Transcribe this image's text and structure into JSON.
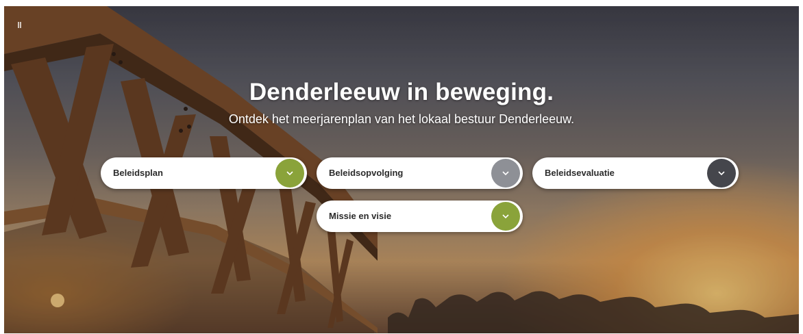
{
  "hero": {
    "title": "Denderleeuw in beweging.",
    "subtitle": "Ontdek het meerjarenplan van het lokaal bestuur Denderleeuw."
  },
  "sections": [
    {
      "label": "Beleidsplan",
      "accent": "#8aa33a",
      "icon": "chevron-down-icon"
    },
    {
      "label": "Beleidsopvolging",
      "accent": "#8e9096",
      "icon": "chevron-down-icon"
    },
    {
      "label": "Beleidsevaluatie",
      "accent": "#45464c",
      "icon": "chevron-down-icon"
    },
    {
      "label": "Missie en visie",
      "accent": "#8aa33a",
      "icon": "chevron-down-icon"
    }
  ],
  "colors": {
    "text_dark": "#2b2b2b",
    "pill_background": "#ffffff",
    "green_accent": "#8aa33a",
    "gray_accent": "#8e9096",
    "dark_accent": "#45464c"
  }
}
